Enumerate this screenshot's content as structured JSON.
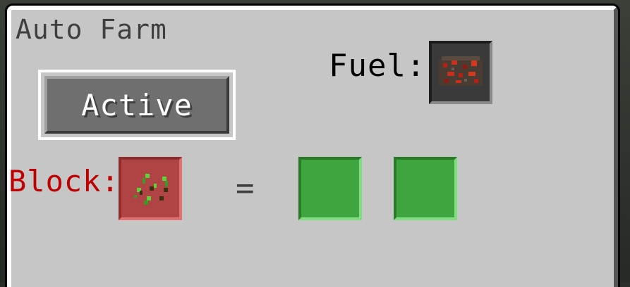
{
  "window": {
    "title": "Auto Farm"
  },
  "fuel": {
    "label": "Fuel:",
    "item_icon": "redstone-ore-icon"
  },
  "toggle": {
    "label": "Active"
  },
  "block": {
    "label": "Block:",
    "item_icon": "seeds-icon",
    "label_color": "#c00000",
    "slot_color": "#b04444"
  },
  "output": {
    "equals_sign": "=",
    "slot_color": "#3fa63f",
    "slots": [
      "empty-slot",
      "empty-slot"
    ]
  }
}
